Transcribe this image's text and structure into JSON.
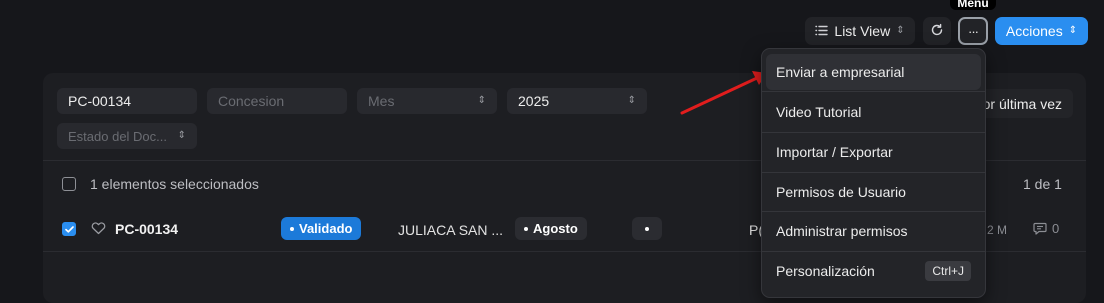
{
  "tooltip": {
    "text": "Menu"
  },
  "toolbar": {
    "list_view_label": "List View",
    "acciones_label": "Acciones",
    "more_label": "···"
  },
  "filters": {
    "id_value": "PC-00134",
    "concesion_placeholder": "Concesion",
    "mes_placeholder": "Mes",
    "year_value": "2025",
    "estado_placeholder": "Estado del Doc...",
    "sort_label": "or última vez"
  },
  "list": {
    "selected_text": "1 elementos seleccionados",
    "pagination": "1 de 1",
    "rows": [
      {
        "id": "PC-00134",
        "status": "Validado",
        "concesion": "JULIACA SAN ...",
        "mes": "Agosto",
        "blank_pill": "",
        "col_partial": "P(",
        "time": "2 M",
        "comments": "0"
      }
    ]
  },
  "menu": {
    "items": [
      {
        "label": "Enviar a empresarial",
        "shortcut": ""
      },
      {
        "label": "Video Tutorial",
        "shortcut": ""
      },
      {
        "label": "Importar / Exportar",
        "shortcut": ""
      },
      {
        "label": "Permisos de Usuario",
        "shortcut": ""
      },
      {
        "label": "Administrar permisos",
        "shortcut": ""
      },
      {
        "label": "Personalización",
        "shortcut": "Ctrl+J"
      }
    ]
  },
  "colors": {
    "accent": "#2a8ef0",
    "arrow": "#e11d1d",
    "background": "#16171b"
  },
  "icons": [
    "list-icon",
    "sort-icon",
    "refresh-icon",
    "more-icon",
    "heart-icon",
    "comment-icon",
    "check-icon",
    "arrow-annotation"
  ]
}
